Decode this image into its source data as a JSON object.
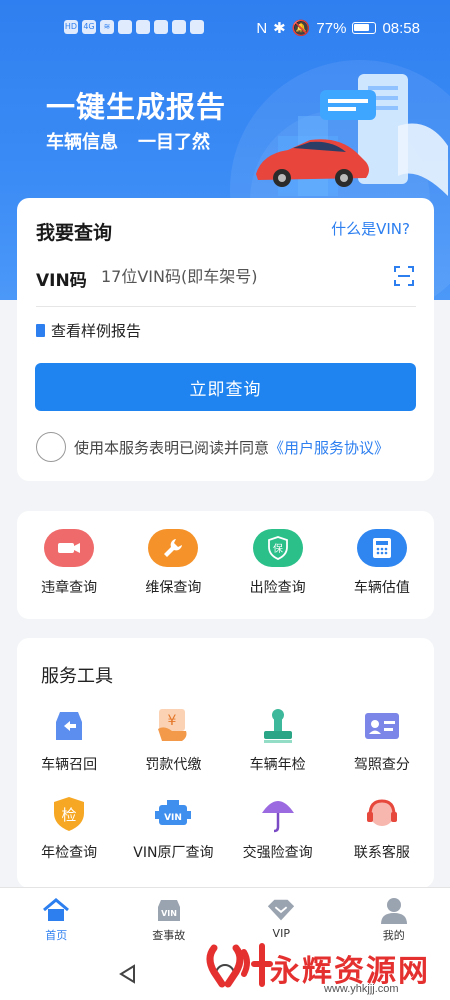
{
  "status_bar": {
    "net": "HD",
    "signal": "4G",
    "battery": "77%",
    "time": "08:58"
  },
  "hero": {
    "title": "一键生成报告",
    "subtitle_left": "车辆信息",
    "subtitle_right": "一目了然"
  },
  "query": {
    "title": "我要查询",
    "what_is_vin": "什么是VIN?",
    "vin_label": "VIN码",
    "vin_placeholder": "17位VIN码(即车架号)",
    "vin_value": "",
    "sample_link": "查看样例报告",
    "submit": "立即查询",
    "agree_text": "使用本服务表明已阅读并同意",
    "agree_link": "《用户服务协议》"
  },
  "quick_actions": [
    {
      "label": "违章查询",
      "icon": "camera-icon",
      "color": "#ef6b6b"
    },
    {
      "label": "维保查询",
      "icon": "wrench-icon",
      "color": "#f5932a"
    },
    {
      "label": "出险查询",
      "icon": "shield-icon",
      "color": "#2bbf8a",
      "glyph": "保"
    },
    {
      "label": "车辆估值",
      "icon": "calculator-icon",
      "color": "#2f86f0"
    }
  ],
  "tools": {
    "title": "服务工具",
    "items": [
      {
        "label": "车辆召回",
        "icon": "car-recall-icon"
      },
      {
        "label": "罚款代缴",
        "icon": "fine-payment-icon",
        "glyph": "¥"
      },
      {
        "label": "车辆年检",
        "icon": "stamp-icon"
      },
      {
        "label": "驾照查分",
        "icon": "id-card-icon"
      },
      {
        "label": "年检查询",
        "icon": "inspection-shield-icon",
        "glyph": "检"
      },
      {
        "label": "VIN原厂查询",
        "icon": "engine-vin-icon",
        "glyph": "VIN"
      },
      {
        "label": "交强险查询",
        "icon": "umbrella-icon"
      },
      {
        "label": "联系客服",
        "icon": "headset-icon"
      }
    ]
  },
  "bottom_nav": [
    {
      "label": "首页",
      "icon": "home-icon",
      "active": true
    },
    {
      "label": "查事故",
      "icon": "vin-car-icon",
      "glyph": "VIN",
      "active": false
    },
    {
      "label": "VIP",
      "icon": "diamond-icon",
      "active": false
    },
    {
      "label": "我的",
      "icon": "user-icon",
      "active": false
    }
  ],
  "watermark": {
    "text": "永辉资源网",
    "url": "www.yhkjjj.com"
  },
  "colors": {
    "primary": "#1f84f0",
    "hero_bg": "#3c8cf6",
    "link": "#2d7ff0"
  }
}
